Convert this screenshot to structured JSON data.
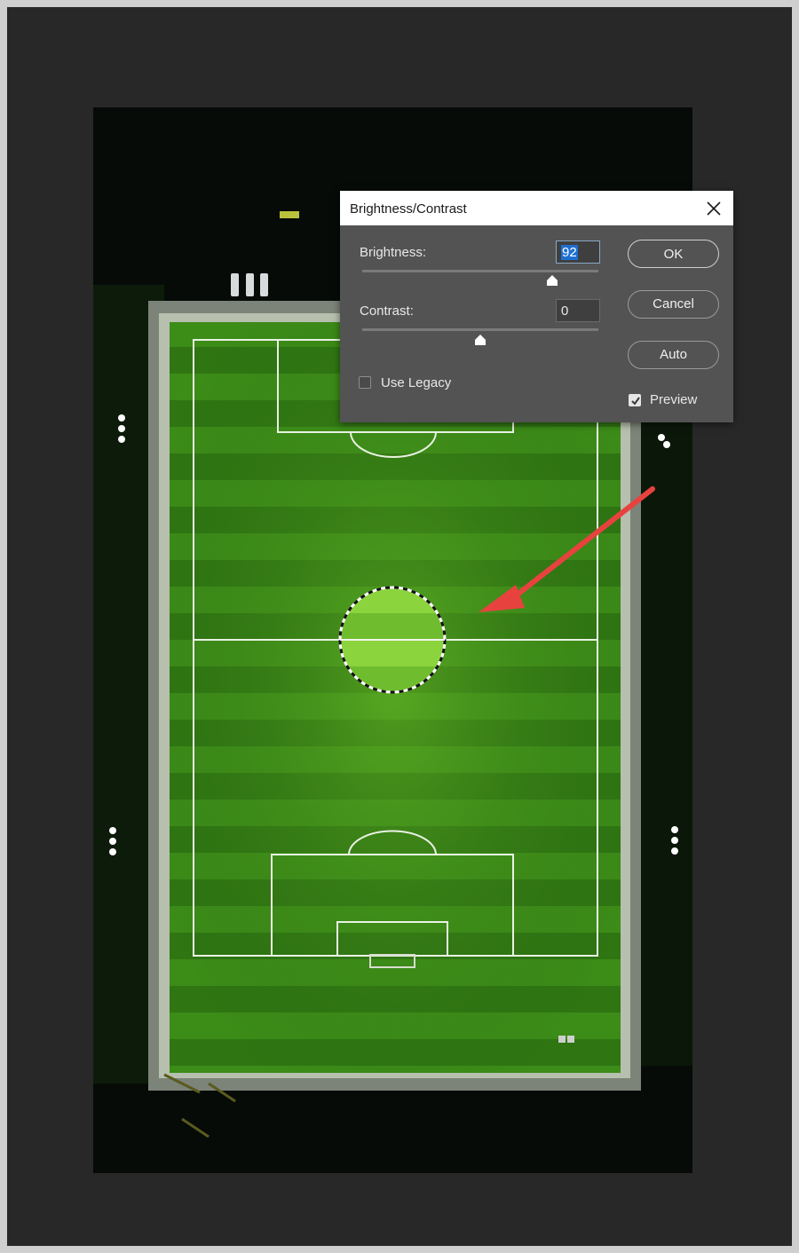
{
  "dialog": {
    "title": "Brightness/Contrast",
    "brightness": {
      "label": "Brightness:",
      "value": "92",
      "slider_level": 0.83
    },
    "contrast": {
      "label": "Contrast:",
      "value": "0",
      "slider_level": 0.5
    },
    "use_legacy": {
      "label": "Use Legacy",
      "checked": false
    },
    "preview": {
      "label": "Preview",
      "checked": true
    },
    "buttons": {
      "ok": "OK",
      "cancel": "Cancel",
      "auto": "Auto"
    }
  },
  "icons": {
    "close": "close-icon",
    "checkmark": "checkmark-icon",
    "slider_thumb": "slider-thumb-icon",
    "annotation_arrow": "arrow-icon"
  },
  "colors": {
    "workspace": "#282828",
    "dialog_bg": "#535353",
    "field_green": "#3f8f1a",
    "annotation_arrow": "#e8423f",
    "selection_highlight": "#1e6fd2"
  }
}
